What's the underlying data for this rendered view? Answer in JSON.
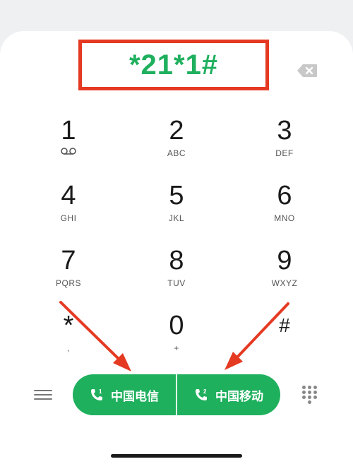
{
  "dialer": {
    "number": "*21*1#"
  },
  "keys": [
    {
      "digit": "1",
      "letters": ""
    },
    {
      "digit": "2",
      "letters": "ABC"
    },
    {
      "digit": "3",
      "letters": "DEF"
    },
    {
      "digit": "4",
      "letters": "GHI"
    },
    {
      "digit": "5",
      "letters": "JKL"
    },
    {
      "digit": "6",
      "letters": "MNO"
    },
    {
      "digit": "7",
      "letters": "PQRS"
    },
    {
      "digit": "8",
      "letters": "TUV"
    },
    {
      "digit": "9",
      "letters": "WXYZ"
    },
    {
      "digit": "*",
      "letters": ","
    },
    {
      "digit": "0",
      "letters": "+"
    },
    {
      "digit": "#",
      "letters": ""
    }
  ],
  "call_buttons": {
    "sim1_label": "中国电信",
    "sim1_badge": "1",
    "sim2_label": "中国移动",
    "sim2_badge": "2"
  },
  "colors": {
    "accent_green": "#1fb05e",
    "annotation_red": "#e53a22"
  },
  "icons": {
    "voicemail": "voicemail-icon",
    "backspace": "backspace-icon",
    "menu": "menu-icon",
    "keypad": "keypad-icon",
    "phone": "phone-icon"
  }
}
